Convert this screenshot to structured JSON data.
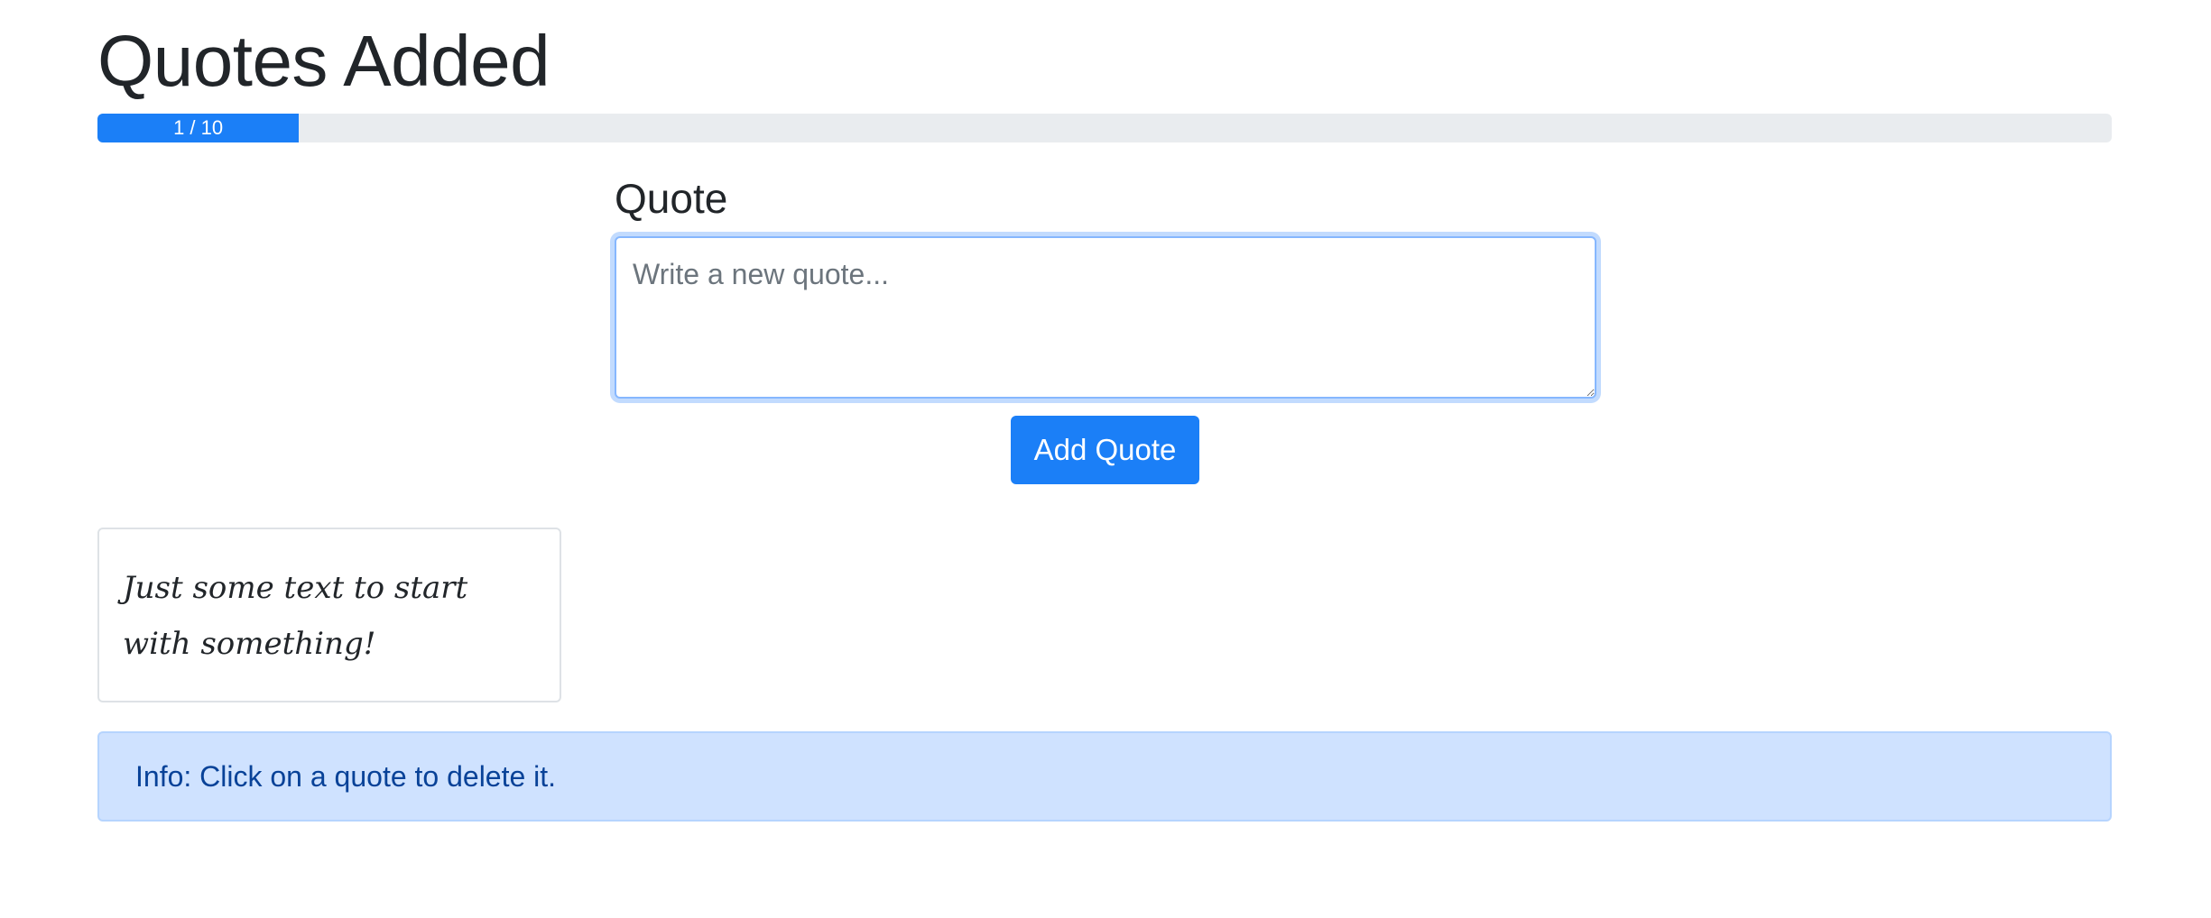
{
  "header": {
    "title": "Quotes Added"
  },
  "progress": {
    "label": "1 / 10",
    "current": 1,
    "max": 10,
    "fraction": 0.1,
    "color": "#1b7ff7"
  },
  "form": {
    "label": "Quote",
    "textarea_placeholder": "Write a new quote...",
    "textarea_value": "",
    "submit_label": "Add Quote"
  },
  "quotes": [
    {
      "text": "Just some text to start with something!"
    }
  ],
  "info": {
    "text": "Info: Click on a quote to delete it."
  },
  "colors": {
    "primary": "#1b7ff7",
    "info_bg": "#cfe2ff",
    "info_text": "#084298"
  }
}
